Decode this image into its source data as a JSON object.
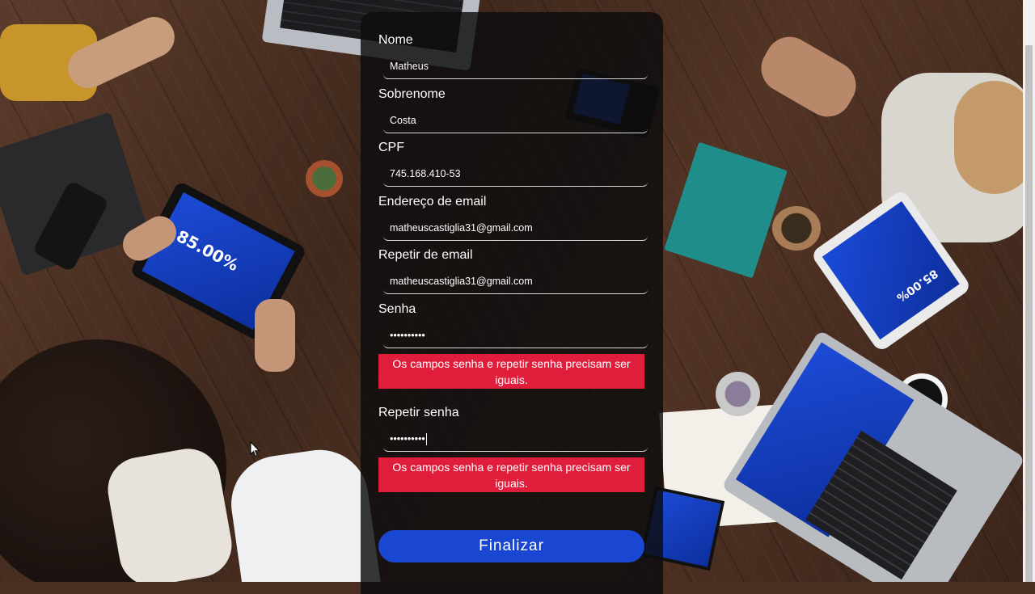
{
  "form": {
    "fields": [
      {
        "label": "Nome",
        "value": "Matheus"
      },
      {
        "label": "Sobrenome",
        "value": "Costa"
      },
      {
        "label": "CPF",
        "value": "745.168.410-53"
      },
      {
        "label": "Endereço de email",
        "value": "matheuscastiglia31@gmail.com"
      },
      {
        "label": "Repetir de email",
        "value": "matheuscastiglia31@gmail.com"
      },
      {
        "label": "Senha",
        "value": "••••••••••"
      },
      {
        "label": "Repetir senha",
        "value": "••••••••••"
      }
    ],
    "errors": {
      "senha": "Os campos senha e repetir senha precisam ser iguais.",
      "repetir_senha": "Os campos senha e repetir senha precisam ser iguais."
    },
    "submit_label": "Finalizar"
  },
  "background_photo_text": {
    "tablet_left": "85.00%",
    "tablet_right": "85.00%"
  },
  "colors": {
    "card_bg": "#0c0c0e",
    "error_bg": "#e01e3c",
    "button_bg": "#1a47d1",
    "text": "#ffffff"
  }
}
